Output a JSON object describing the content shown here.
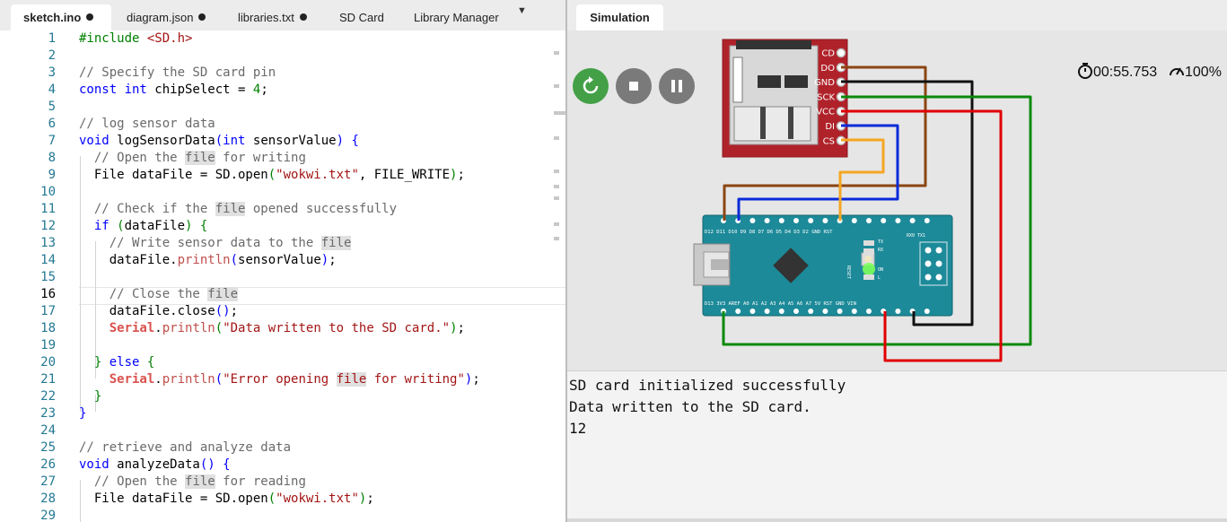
{
  "editor": {
    "tabs": [
      {
        "label": "sketch.ino",
        "modified": true,
        "active": true
      },
      {
        "label": "diagram.json",
        "modified": true
      },
      {
        "label": "libraries.txt",
        "modified": true
      },
      {
        "label": "SD Card"
      },
      {
        "label": "Library Manager"
      }
    ],
    "line_numbers": [
      "1",
      "2",
      "3",
      "4",
      "5",
      "6",
      "7",
      "8",
      "9",
      "10",
      "11",
      "12",
      "13",
      "14",
      "15",
      "16",
      "17",
      "18",
      "19",
      "20",
      "21",
      "22",
      "23",
      "24",
      "25",
      "26",
      "27",
      "28",
      "29"
    ],
    "code": {
      "l1": {
        "a": "#include ",
        "b": "<SD.h>"
      },
      "l3": {
        "a": "// Specify the SD card pin"
      },
      "l4": {
        "a": "const int",
        "b": " chipSelect = ",
        "c": "4",
        "d": ";"
      },
      "l6": {
        "a": "// log sensor data"
      },
      "l7": {
        "a": "void",
        "b": " logSensorData",
        "c": "(",
        "d": "int",
        "e": " sensorValue",
        "f": ")",
        "g": " {"
      },
      "l8": {
        "a": "  // Open the ",
        "b": "file",
        "c": " for writing"
      },
      "l9": {
        "a": "  File dataFile = SD.open",
        "b": "(",
        "c": "\"wokwi.txt\"",
        "d": ", FILE_WRITE",
        "e": ")",
        "f": ";"
      },
      "l11": {
        "a": "  // Check if the ",
        "b": "file",
        "c": " opened successfully"
      },
      "l12": {
        "a": "  if",
        "b": " (",
        "c": "dataFile",
        "d": ")",
        "e": " {"
      },
      "l13": {
        "a": "    // Write sensor data to the ",
        "b": "file"
      },
      "l14": {
        "a": "    dataFile.",
        "b": "println",
        "c": "(",
        "d": "sensorValue",
        "e": ")",
        "f": ";"
      },
      "l16": {
        "a": "    // Close the ",
        "b": "file"
      },
      "l17": {
        "a": "    dataFile.close",
        "b": "()",
        "c": ";"
      },
      "l18": {
        "a": "    ",
        "b": "Serial",
        "c": ".",
        "d": "println",
        "e": "(",
        "f": "\"Data written to the SD card.\"",
        "g": ")",
        "h": ";"
      },
      "l20": {
        "a": "  }",
        "b": " else",
        "c": " {"
      },
      "l21": {
        "a": "    ",
        "b": "Serial",
        "c": ".",
        "d": "println",
        "e": "(",
        "f": "\"Error opening ",
        "g": "file",
        "h": " for writing\"",
        "i": ")",
        "j": ";"
      },
      "l22": {
        "a": "  }"
      },
      "l23": {
        "a": "}"
      },
      "l25": {
        "a": "// retrieve and analyze data"
      },
      "l26": {
        "a": "void",
        "b": " analyzeData",
        "c": "()",
        "d": " {"
      },
      "l27": {
        "a": "  // Open the ",
        "b": "file",
        "c": " for reading"
      },
      "l28": {
        "a": "  File dataFile = SD.open",
        "b": "(",
        "c": "\"wokwi.txt\"",
        "d": ")",
        "e": ";"
      }
    }
  },
  "simulation": {
    "tab_label": "Simulation",
    "timer": "00:55.753",
    "speed": "100%",
    "sd_pins": [
      "CD",
      "DO",
      "GND",
      "SCK",
      "VCC",
      "DI",
      "CS"
    ],
    "nano_top_pins": "D12 D11 D10 D9 D8 D7 D6 D5 D4 D3 D2 GND RST",
    "nano_top_right": "RX0 TX1",
    "nano_bottom_pins": "D13 3V3 AREF A0 A1 A2 A3 A4 A5 A6 A7 5V RST GND VIN",
    "nano_reset_label": "RESET",
    "nano_led_labels": [
      "TX",
      "RX",
      "ON",
      "L"
    ],
    "colors": {
      "play": "#43a047",
      "control": "#7a7a7a",
      "sd_board": "#b0222a",
      "nano_board": "#1d8a99",
      "wire_brown": "#8b4513",
      "wire_black": "#111111",
      "wire_green": "#0a8a0a",
      "wire_red": "#e00000",
      "wire_blue": "#0a2bd9",
      "wire_orange": "#f5a623"
    }
  },
  "serial_monitor": {
    "lines": [
      "SD card initialized successfully",
      "Data written to the SD card.",
      "12"
    ]
  }
}
